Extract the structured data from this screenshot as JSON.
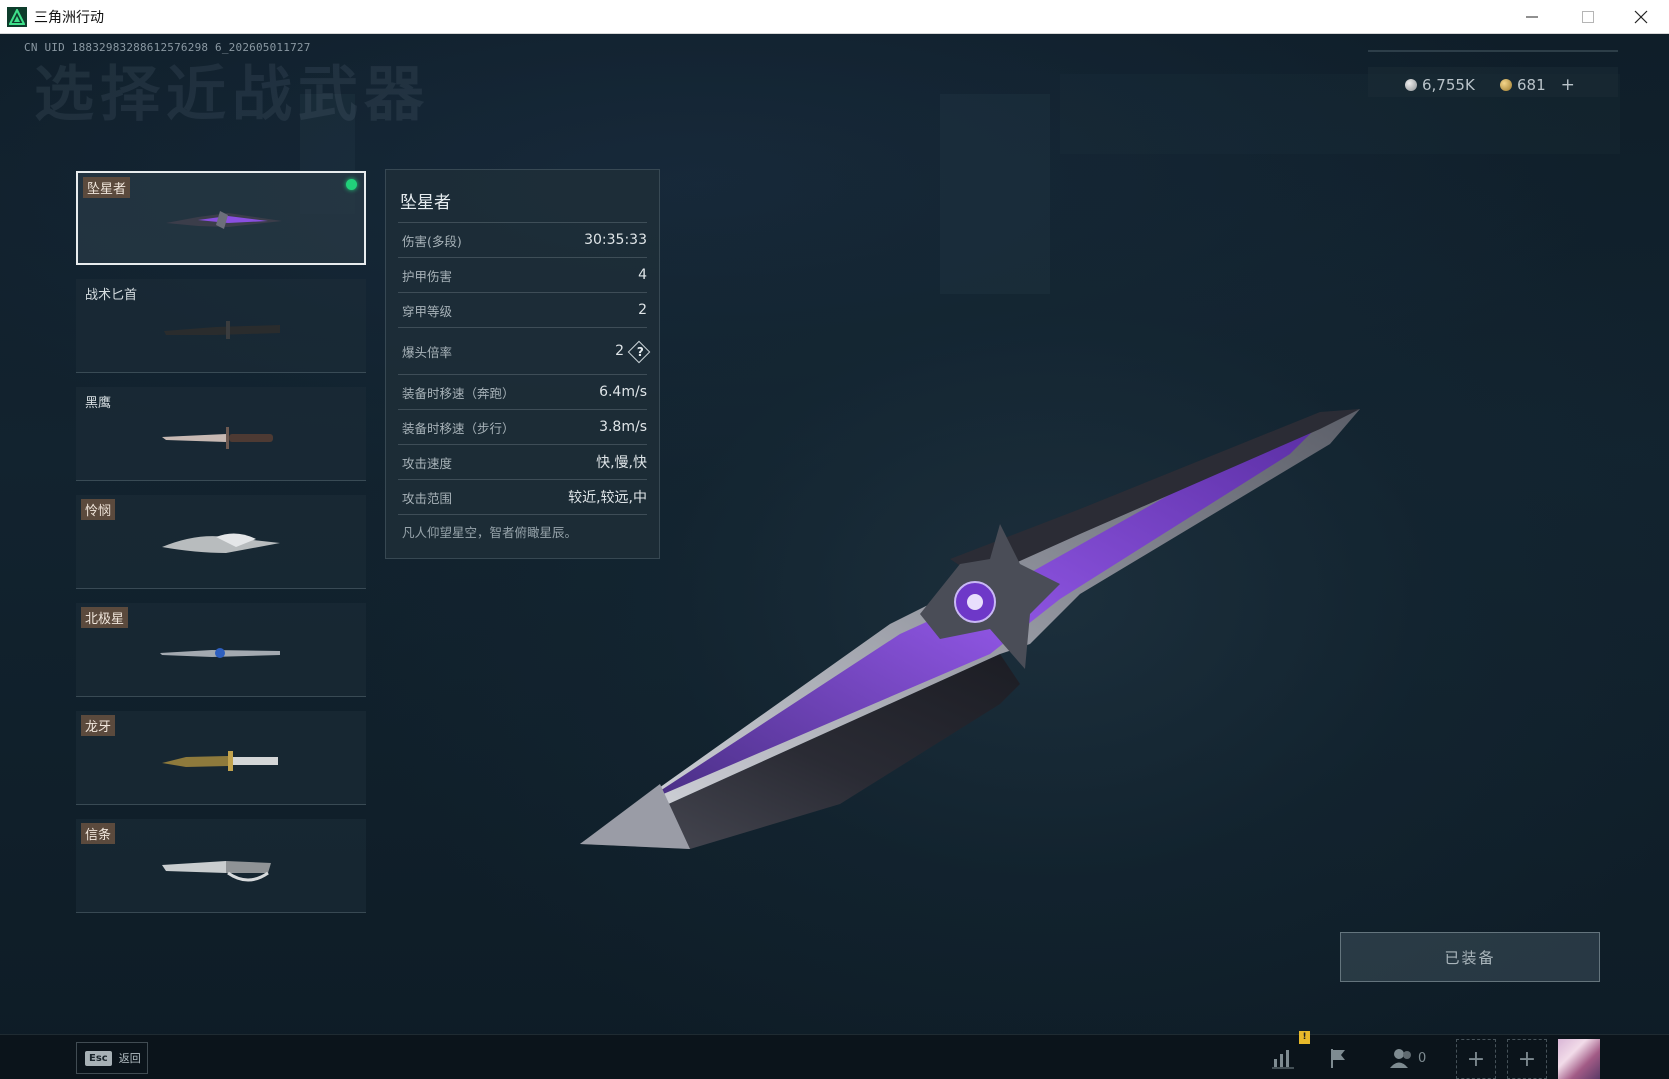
{
  "window": {
    "title": "三角洲行动",
    "controls": [
      "minimize-icon",
      "maximize-icon",
      "close-icon"
    ]
  },
  "header": {
    "uid": "CN UID 18832983288612576298 6_202605011727",
    "page_title": "选择近战武器"
  },
  "currency": {
    "silver": "6,755K",
    "gold": "681",
    "add": "+"
  },
  "weapons": [
    {
      "name": "坠星者",
      "tagged": true,
      "selected": true,
      "equipped": true
    },
    {
      "name": "战术匕首",
      "tagged": false,
      "selected": false,
      "equipped": false
    },
    {
      "name": "黑鹰",
      "tagged": false,
      "selected": false,
      "equipped": false
    },
    {
      "name": "怜悯",
      "tagged": true,
      "selected": false,
      "equipped": false
    },
    {
      "name": "北极星",
      "tagged": true,
      "selected": false,
      "equipped": false
    },
    {
      "name": "龙牙",
      "tagged": true,
      "selected": false,
      "equipped": false
    },
    {
      "name": "信条",
      "tagged": true,
      "selected": false,
      "equipped": false
    }
  ],
  "stats": {
    "title": "坠星者",
    "rows": [
      {
        "label": "伤害(多段)",
        "value": "30:35:33"
      },
      {
        "label": "护甲伤害",
        "value": "4"
      },
      {
        "label": "穿甲等级",
        "value": "2"
      },
      {
        "label": "爆头倍率",
        "value": "2",
        "help": "?"
      },
      {
        "label": "装备时移速（奔跑）",
        "value": "6.4m/s"
      },
      {
        "label": "装备时移速（步行）",
        "value": "3.8m/s"
      },
      {
        "label": "攻击速度",
        "value": "快,慢,快"
      },
      {
        "label": "攻击范围",
        "value": "较近,较远,中"
      }
    ],
    "description": "凡人仰望星空，智者俯瞰星辰。"
  },
  "equip_button": {
    "label": "已装备"
  },
  "bottom_bar": {
    "esc_key": "Esc",
    "esc_label": "返回",
    "notification_badge": "!",
    "friends_count": "0",
    "icons": [
      "stats-icon",
      "flag-icon",
      "friends-icon"
    ]
  },
  "colors": {
    "equipped_dot": "#21d07a",
    "blade_purple": "#7b3fd6",
    "tag_bg": "#5b4a3d"
  }
}
